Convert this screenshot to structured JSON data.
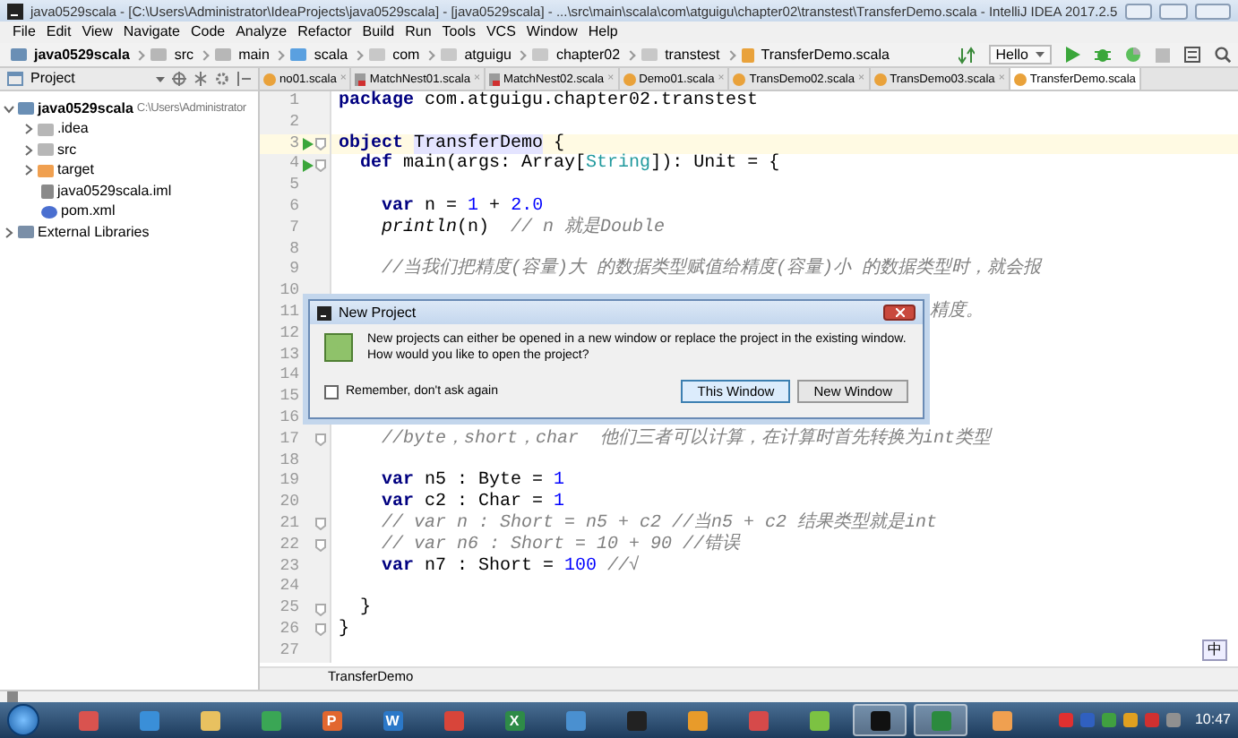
{
  "window": {
    "title": "java0529scala - [C:\\Users\\Administrator\\IdeaProjects\\java0529scala] - [java0529scala] - ...\\src\\main\\scala\\com\\atguigu\\chapter02\\transtest\\TransferDemo.scala - IntelliJ IDEA 2017.2.5"
  },
  "menu": [
    "File",
    "Edit",
    "View",
    "Navigate",
    "Code",
    "Analyze",
    "Refactor",
    "Build",
    "Run",
    "Tools",
    "VCS",
    "Window",
    "Help"
  ],
  "breadcrumbs": [
    {
      "label": "java0529scala",
      "kind": "project"
    },
    {
      "label": "src",
      "kind": "folder"
    },
    {
      "label": "main",
      "kind": "folder"
    },
    {
      "label": "scala",
      "kind": "source"
    },
    {
      "label": "com",
      "kind": "package"
    },
    {
      "label": "atguigu",
      "kind": "package"
    },
    {
      "label": "chapter02",
      "kind": "package"
    },
    {
      "label": "transtest",
      "kind": "package"
    },
    {
      "label": "TransferDemo.scala",
      "kind": "file"
    }
  ],
  "run_config": {
    "label": "Hello"
  },
  "project_panel": {
    "title": "Project",
    "tree": [
      {
        "label": "java0529scala",
        "path": "C:\\Users\\Administrator",
        "kind": "project",
        "expanded": true,
        "children": [
          {
            "label": ".idea",
            "kind": "folder",
            "expanded": false
          },
          {
            "label": "src",
            "kind": "folder",
            "expanded": false
          },
          {
            "label": "target",
            "kind": "excluded",
            "expanded": false
          },
          {
            "label": "java0529scala.iml",
            "kind": "iml"
          },
          {
            "label": "pom.xml",
            "kind": "maven"
          }
        ]
      },
      {
        "label": "External Libraries",
        "kind": "libraries",
        "expanded": false
      }
    ]
  },
  "tabs": [
    {
      "label": "no01.scala",
      "kind": "object",
      "close": "×",
      "selected": false
    },
    {
      "label": "MatchNest01.scala",
      "kind": "file",
      "close": "×",
      "selected": false
    },
    {
      "label": "MatchNest02.scala",
      "kind": "file",
      "close": "×",
      "selected": false
    },
    {
      "label": "Demo01.scala",
      "kind": "object",
      "close": "×",
      "selected": false
    },
    {
      "label": "TransDemo02.scala",
      "kind": "object",
      "close": "×",
      "selected": false
    },
    {
      "label": "TransDemo03.scala",
      "kind": "object",
      "close": "×",
      "selected": false
    },
    {
      "label": "TransferDemo.scala",
      "kind": "object",
      "selected": true
    }
  ],
  "editor": {
    "lines": [
      {
        "number": "1",
        "segments": [
          {
            "kind": "kw",
            "text": "package"
          },
          {
            "kind": "plain",
            "text": " com.atguigu.chapter02.transtest"
          }
        ]
      },
      {
        "number": "2"
      },
      {
        "number": "3",
        "current": true,
        "run": true,
        "fold": true,
        "segments": [
          {
            "kind": "kw",
            "text": "object "
          },
          {
            "kind": "ident",
            "text": "TransferDemo"
          },
          {
            "kind": "plain",
            "text": " {"
          }
        ]
      },
      {
        "number": "4",
        "run": true,
        "fold": true,
        "segments": [
          {
            "kind": "kw",
            "text": "  def"
          },
          {
            "kind": "plain",
            "text": " main(args: Array["
          },
          {
            "kind": "type",
            "text": "String"
          },
          {
            "kind": "plain",
            "text": "]): Unit = {"
          }
        ]
      },
      {
        "number": "5"
      },
      {
        "number": "6",
        "segments": [
          {
            "kind": "kw",
            "text": "    var"
          },
          {
            "kind": "plain",
            "text": " n = "
          },
          {
            "kind": "num",
            "text": "1"
          },
          {
            "kind": "plain",
            "text": " + "
          },
          {
            "kind": "num",
            "text": "2.0"
          }
        ]
      },
      {
        "number": "7",
        "segments": [
          {
            "kind": "fn",
            "text": "    println"
          },
          {
            "kind": "plain",
            "text": "(n)  "
          },
          {
            "kind": "cmt",
            "text": "// n 就是Double"
          }
        ]
      },
      {
        "number": "8"
      },
      {
        "number": "9",
        "segments": [
          {
            "kind": "cmt",
            "text": "    //当我们把精度(容量)大 的数据类型赋值给精度(容量)小 的数据类型时，就会报"
          }
        ]
      },
      {
        "number": "10"
      },
      {
        "number": "11",
        "tail": true,
        "segments": [
          {
            "kind": "cmt",
            "text": "精度。"
          }
        ]
      },
      {
        "number": "12"
      },
      {
        "number": "13"
      },
      {
        "number": "14"
      },
      {
        "number": "15"
      },
      {
        "number": "16"
      },
      {
        "number": "17",
        "fold": true,
        "segments": [
          {
            "kind": "cmt",
            "text": "    //byte，short，char  他们三者可以计算，在计算时首先转换为int类型"
          }
        ]
      },
      {
        "number": "18"
      },
      {
        "number": "19",
        "segments": [
          {
            "kind": "kw",
            "text": "    var"
          },
          {
            "kind": "plain",
            "text": " n5 : Byte = "
          },
          {
            "kind": "num",
            "text": "1"
          }
        ]
      },
      {
        "number": "20",
        "segments": [
          {
            "kind": "kw",
            "text": "    var"
          },
          {
            "kind": "plain",
            "text": " c2 : Char = "
          },
          {
            "kind": "num",
            "text": "1"
          }
        ]
      },
      {
        "number": "21",
        "fold": true,
        "segments": [
          {
            "kind": "cmt",
            "text": "    // var n : Short = n5 + c2 //当n5 + c2 结果类型就是int"
          }
        ]
      },
      {
        "number": "22",
        "fold": true,
        "segments": [
          {
            "kind": "cmt",
            "text": "    // var n6 : Short = 10 + 90 //错误"
          }
        ]
      },
      {
        "number": "23",
        "segments": [
          {
            "kind": "kw",
            "text": "    var"
          },
          {
            "kind": "plain",
            "text": " n7 : Short = "
          },
          {
            "kind": "num",
            "text": "100"
          },
          {
            "kind": "cmt",
            "text": " //√"
          }
        ]
      },
      {
        "number": "24"
      },
      {
        "number": "25",
        "fold": true,
        "segments": [
          {
            "kind": "plain",
            "text": "  }"
          }
        ]
      },
      {
        "number": "26",
        "fold": true,
        "segments": [
          {
            "kind": "plain",
            "text": "}"
          }
        ]
      },
      {
        "number": "27"
      }
    ],
    "footer": "TransferDemo"
  },
  "dialog": {
    "title": "New Project",
    "message": [
      "New projects can either be opened in a new window or replace the project in the existing window.",
      "How would you like to open the project?"
    ],
    "checkbox": {
      "label": "Remember, don't ask again",
      "checked": false
    },
    "buttons": [
      {
        "label": "This Window",
        "selected": true
      },
      {
        "label": "New Window",
        "selected": false
      }
    ]
  },
  "ime_bar": {
    "label": "中"
  },
  "taskbar": {
    "apps": [
      {
        "color": "#d9534f",
        "active": false
      },
      {
        "color": "#3a8fd8",
        "active": false
      },
      {
        "color": "#e8c160",
        "active": false
      },
      {
        "color": "#3aa655",
        "active": false
      },
      {
        "color": "#e2672f",
        "label": "P",
        "active": false
      },
      {
        "color": "#2b78c8",
        "label": "W",
        "active": false
      },
      {
        "color": "#d8453a",
        "active": false
      },
      {
        "color": "#2e8b47",
        "label": "X",
        "active": false
      },
      {
        "color": "#4a90d0",
        "active": false
      },
      {
        "color": "#222222",
        "active": false
      },
      {
        "color": "#e89b2a",
        "active": false
      },
      {
        "color": "#d64a4a",
        "active": false
      },
      {
        "color": "#7cc242",
        "active": false
      },
      {
        "color": "#111111",
        "active": true
      },
      {
        "color": "#2b8a3e",
        "active": true
      },
      {
        "color": "#f0a050",
        "active": false
      }
    ],
    "tray": [
      {
        "color": "#e03030"
      },
      {
        "color": "#3060c0"
      },
      {
        "color": "#40a040"
      },
      {
        "color": "#e0a020"
      },
      {
        "color": "#d03030"
      },
      {
        "color": "#909090"
      }
    ],
    "clock": "10:47"
  }
}
